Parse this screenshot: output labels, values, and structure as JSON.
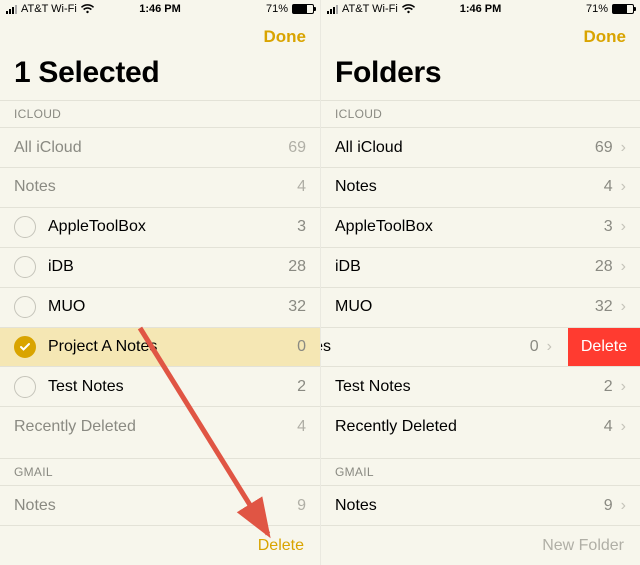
{
  "status": {
    "carrier": "AT&T Wi-Fi",
    "time": "1:46 PM",
    "battery_pct": "71%"
  },
  "left": {
    "done": "Done",
    "title": "1 Selected",
    "sections": {
      "icloud": "ICLOUD",
      "gmail": "GMAIL"
    },
    "rows": {
      "all_icloud": {
        "label": "All iCloud",
        "count": "69"
      },
      "notes": {
        "label": "Notes",
        "count": "4"
      },
      "atb": {
        "label": "AppleToolBox",
        "count": "3"
      },
      "idb": {
        "label": "iDB",
        "count": "28"
      },
      "muo": {
        "label": "MUO",
        "count": "32"
      },
      "projA": {
        "label": "Project A Notes",
        "count": "0"
      },
      "test": {
        "label": "Test Notes",
        "count": "2"
      },
      "recent": {
        "label": "Recently Deleted",
        "count": "4"
      },
      "gmail": {
        "label": "Notes",
        "count": "9"
      }
    },
    "toolbar_delete": "Delete"
  },
  "right": {
    "done": "Done",
    "title": "Folders",
    "sections": {
      "icloud": "ICLOUD",
      "gmail": "GMAIL"
    },
    "rows": {
      "all_icloud": {
        "label": "All iCloud",
        "count": "69"
      },
      "notes": {
        "label": "Notes",
        "count": "4"
      },
      "atb": {
        "label": "AppleToolBox",
        "count": "3"
      },
      "idb": {
        "label": "iDB",
        "count": "28"
      },
      "muo": {
        "label": "MUO",
        "count": "32"
      },
      "projA": {
        "label": "A Notes",
        "count": "0"
      },
      "test": {
        "label": "Test Notes",
        "count": "2"
      },
      "recent": {
        "label": "Recently Deleted",
        "count": "4"
      },
      "gmail": {
        "label": "Notes",
        "count": "9"
      }
    },
    "swipe_delete": "Delete",
    "toolbar_new": "New Folder"
  }
}
